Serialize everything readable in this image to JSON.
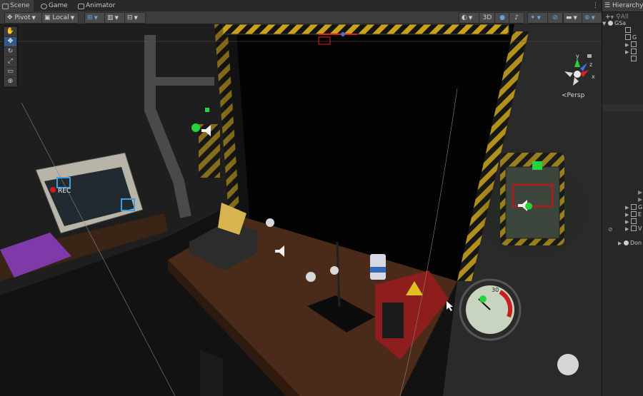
{
  "tabs": [
    {
      "label": "Scene",
      "icon": "scene-grid-icon",
      "active": true
    },
    {
      "label": "Game",
      "icon": "game-controller-icon",
      "active": false
    },
    {
      "label": "Animator",
      "icon": "animator-icon",
      "active": false
    }
  ],
  "tab_menu": "⋮",
  "toolbar": {
    "pivot": "Pivot",
    "local": "Local",
    "mode_2d3d": "3D"
  },
  "tools": [
    "hand-tool",
    "move-tool",
    "rotate-tool",
    "scale-tool",
    "rect-tool",
    "transform-tool"
  ],
  "gizmo": {
    "y": "y",
    "z": "z",
    "x": "x",
    "persp": "Persp"
  },
  "hierarchy": {
    "title": "Hierarchy",
    "add": "+",
    "search": "All",
    "rows": [
      {
        "label": "GSa",
        "indent": 0,
        "icon": "unity-scene"
      },
      {
        "label": "",
        "indent": 1,
        "icon": "cube"
      },
      {
        "label": "G",
        "indent": 1,
        "icon": "cube"
      },
      {
        "label": "",
        "indent": 2,
        "icon": "cube"
      },
      {
        "label": "",
        "indent": 2,
        "icon": "cube"
      },
      {
        "label": "",
        "indent": 3,
        "icon": "cube"
      },
      {
        "label": "G",
        "indent": 1,
        "icon": "cube"
      },
      {
        "label": "E",
        "indent": 1,
        "icon": "cube"
      },
      {
        "label": "",
        "indent": 1,
        "icon": "cube"
      },
      {
        "label": "V",
        "indent": 1,
        "icon": "cube"
      },
      {
        "label": "Don",
        "indent": 0,
        "icon": "unity-scene"
      }
    ]
  },
  "scene_labels": {
    "rec": "REC",
    "gauge_number": "30"
  },
  "colors": {
    "accent": "#2f5c8a",
    "gizmo_green": "#27d33a",
    "hazard_yellow": "#c9a21a",
    "record_red": "#d21b1b"
  }
}
